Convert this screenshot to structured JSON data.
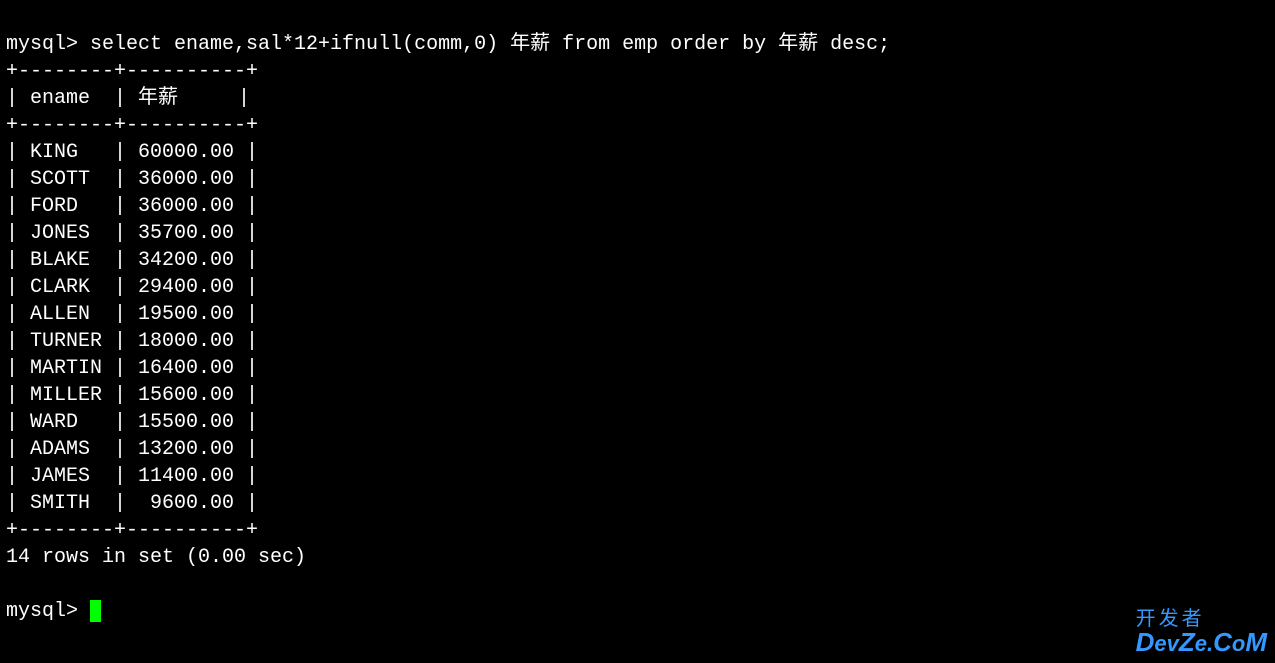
{
  "prompt": "mysql> ",
  "query": "select ename,sal*12+ifnull(comm,0) 年薪 from emp order by 年薪 desc;",
  "table": {
    "border_top": "+--------+----------+",
    "border_mid": "+--------+----------+",
    "border_bottom": "+--------+----------+",
    "header": {
      "col1": "ename",
      "col2": "年薪"
    },
    "rows": [
      {
        "ename": "KING",
        "salary": "60000.00"
      },
      {
        "ename": "SCOTT",
        "salary": "36000.00"
      },
      {
        "ename": "FORD",
        "salary": "36000.00"
      },
      {
        "ename": "JONES",
        "salary": "35700.00"
      },
      {
        "ename": "BLAKE",
        "salary": "34200.00"
      },
      {
        "ename": "CLARK",
        "salary": "29400.00"
      },
      {
        "ename": "ALLEN",
        "salary": "19500.00"
      },
      {
        "ename": "TURNER",
        "salary": "18000.00"
      },
      {
        "ename": "MARTIN",
        "salary": "16400.00"
      },
      {
        "ename": "MILLER",
        "salary": "15600.00"
      },
      {
        "ename": "WARD",
        "salary": "15500.00"
      },
      {
        "ename": "ADAMS",
        "salary": "13200.00"
      },
      {
        "ename": "JAMES",
        "salary": "11400.00"
      },
      {
        "ename": "SMITH",
        "salary": " 9600.00"
      }
    ]
  },
  "result_status": "14 rows in set (0.00 sec)",
  "prompt2": "mysql> ",
  "watermark": {
    "line1": "开发者",
    "line2_a": "D",
    "line2_b": "ev",
    "line2_c": "Z",
    "line2_d": "e.",
    "line2_e": "C",
    "line2_f": "o",
    "line2_g": "M"
  }
}
